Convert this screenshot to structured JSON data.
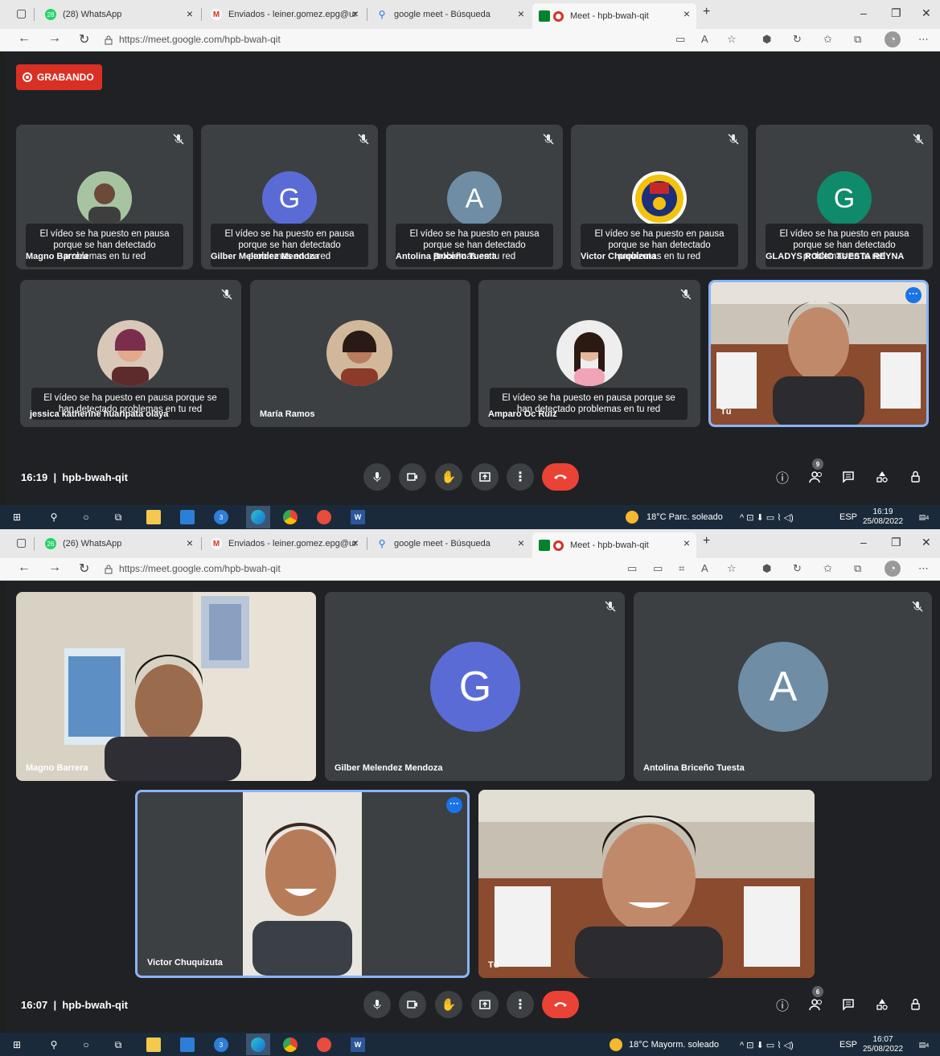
{
  "browser": {
    "tabs_top": [
      {
        "label": "(28) WhatsApp",
        "badge": "28"
      },
      {
        "label": "Enviados - leiner.gomez.epg@ur"
      },
      {
        "label": "google meet - Búsqueda"
      },
      {
        "label": "Meet - hpb-bwah-qit"
      }
    ],
    "tabs_bottom": [
      {
        "label": "(26) WhatsApp",
        "badge": "26"
      },
      {
        "label": "Enviados - leiner.gomez.epg@ur"
      },
      {
        "label": "google meet - Búsqueda"
      },
      {
        "label": "Meet - hpb-bwah-qit"
      }
    ],
    "url": "https://meet.google.com/hpb-bwah-qit"
  },
  "meet_top": {
    "recording_label": "GRABANDO",
    "pause_msg": "El vídeo se ha puesto en pausa porque se han detectado problemas en tu red",
    "row1": [
      {
        "name": "Magno Barrera",
        "initial": ""
      },
      {
        "name": "Gilber Melendez Mendoza",
        "initial": "G",
        "color": "#5b6bd6"
      },
      {
        "name": "Antolina Briceño Tuesta",
        "initial": "A",
        "color": "#6f8ea5"
      },
      {
        "name": "Victor Chuquizuta",
        "initial": ""
      },
      {
        "name": "GLADYS ROCIO TUESTA REYNA",
        "initial": "G",
        "color": "#0f8a6a"
      }
    ],
    "row2": [
      {
        "name": "jessica katherine huaripata olaya"
      },
      {
        "name": "María Ramos"
      },
      {
        "name": "Amparo Oc Ruiz"
      },
      {
        "name": "Tú"
      }
    ],
    "clock": "16:19",
    "meeting_code": "hpb-bwah-qit",
    "participants_count": "9"
  },
  "meet_bottom": {
    "tiles": [
      {
        "name": "Magno Barrera"
      },
      {
        "name": "Gilber Melendez Mendoza",
        "initial": "G",
        "color": "#5b6bd6"
      },
      {
        "name": "Antolina Briceño Tuesta",
        "initial": "A",
        "color": "#6f8ea5"
      },
      {
        "name": "Victor Chuquizuta"
      },
      {
        "name": "Tú"
      }
    ],
    "clock": "16:07",
    "meeting_code": "hpb-bwah-qit",
    "participants_count": "6"
  },
  "taskbar_top": {
    "weather": "18°C Parc. soleado",
    "lang": "ESP",
    "time": "16:19",
    "date": "25/08/2022",
    "notif": "4",
    "mail_count": "3"
  },
  "taskbar_bottom": {
    "weather": "18°C Mayorm. soleado",
    "lang": "ESP",
    "time": "16:07",
    "date": "25/08/2022",
    "notif": "4",
    "mail_count": "3"
  },
  "colors": {
    "meet_bg": "#202124",
    "tile_bg": "#3c4043",
    "record_red": "#d93025",
    "hangup_red": "#ea4335",
    "selected_border": "#8ab4f8"
  }
}
